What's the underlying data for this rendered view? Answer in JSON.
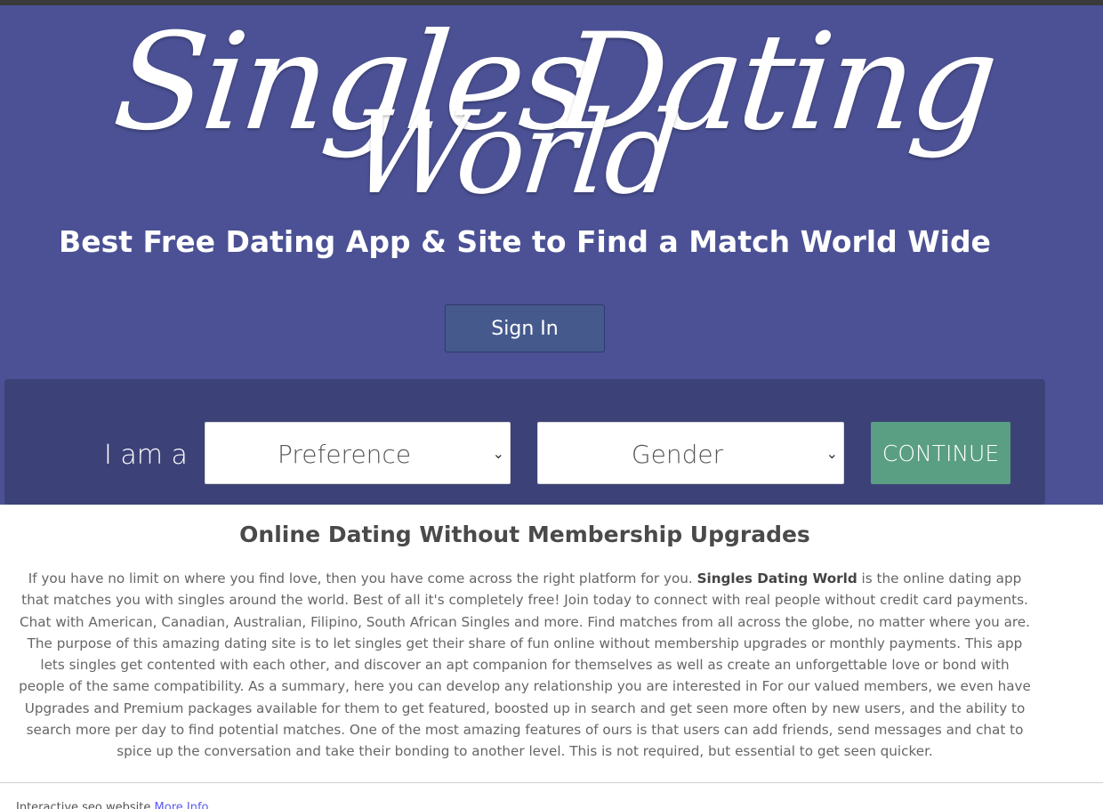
{
  "logo": {
    "line1_a": "Singles",
    "line1_b": "Dating",
    "line2": "World"
  },
  "hero": {
    "tagline": "Best Free Dating App & Site to Find a Match World Wide",
    "signin_label": "Sign In"
  },
  "form": {
    "prefix": "I am a",
    "preference_value": "Preference",
    "gender_value": "Gender",
    "continue_label": "CONTINUE"
  },
  "content": {
    "heading": "Online Dating Without Membership Upgrades",
    "para_before": "If you have no limit on where you find love, then you have come across the right platform for you. ",
    "para_bold": "Singles Dating World",
    "para_after": " is the online dating app that matches you with singles around the world. Best of all it's completely free! Join today to connect with real people without credit card payments. Chat with American, Canadian, Australian, Filipino, South African Singles and more. Find matches from all across the globe, no matter where you are. The purpose of this amazing dating site is to let singles get their share of fun online without membership upgrades or monthly payments. This app lets singles get contented with each other, and discover an apt companion for themselves as well as create an unforgettable love or bond with people of the same compatibility. As a summary, here you can develop any relationship you are interested in For our valued members, we even have Upgrades and Premium packages available for them to get featured, boosted up in search and get seen more often by new users, and the ability to search more per day to find potential matches. One of the most amazing features of ours is that users can add friends, send messages and chat to spice up the conversation and take their bonding to another level. This is not required, but essential to get seen quicker."
  },
  "footer": {
    "text": "Interactive seo website",
    "link": "More Info"
  },
  "colors": {
    "hero_bg": "#4b5194",
    "panel_bg": "#3c4277",
    "signin_bg": "#45598d",
    "continue_bg": "#5a9f84"
  }
}
